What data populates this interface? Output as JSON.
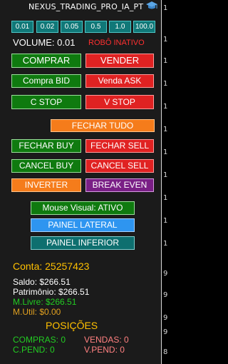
{
  "title": "NEXUS_TRADING_PRO_IA_PT",
  "volume_buttons": [
    "0.01",
    "0.02",
    "0.05",
    "0.5",
    "1.0",
    "100.0"
  ],
  "volume": {
    "label": "VOLUME: 0.01",
    "robot_status": "ROBÔ INATIVO"
  },
  "buttons": {
    "comprar": "COMPRAR",
    "vender": "VENDER",
    "compra_bid": "Compra BID",
    "venda_ask": "Venda ASK",
    "c_stop": "C STOP",
    "v_stop": "V STOP",
    "fechar_tudo": "FECHAR TUDO",
    "fechar_buy": "FECHAR BUY",
    "fechar_sell": "FECHAR SELL",
    "cancel_buy": "CANCEL BUY",
    "cancel_sell": "CANCEL SELL",
    "inverter": "INVERTER",
    "break_even": "BREAK EVEN",
    "mouse_visual": "Mouse Visual: ATIVO",
    "painel_lateral": "PAINEL LATERAL",
    "painel_inferior": "PAINEL INFERIOR"
  },
  "account": {
    "conta": "Conta: 25257423",
    "saldo": "Saldo: $266.51",
    "patrimonio": "Patrimônio: $266.51",
    "mlivre": "M.Livre: $266.51",
    "mutil": "M.Util: $0.00"
  },
  "positions": {
    "header": "POSIÇÕES",
    "compras": "COMPRAS: 0",
    "vendas": "VENDAS: 0",
    "cpend": "C.PEND: 0",
    "vpend": "V.PEND: 0"
  },
  "price_scale_digits": [
    "1",
    "1",
    "1",
    "1",
    "1",
    "1",
    "1",
    "1",
    "1",
    "1",
    "1",
    "9",
    "9",
    "9",
    "9",
    "8"
  ],
  "colors": {
    "accent_yellow": "#ffc000",
    "robot_inactive": "#ff3030",
    "green_text": "#22cc22",
    "orange_text": "#e0a020",
    "pink_text": "#ff8080"
  },
  "icons": {
    "title_icon": "graduation-cap-icon"
  }
}
